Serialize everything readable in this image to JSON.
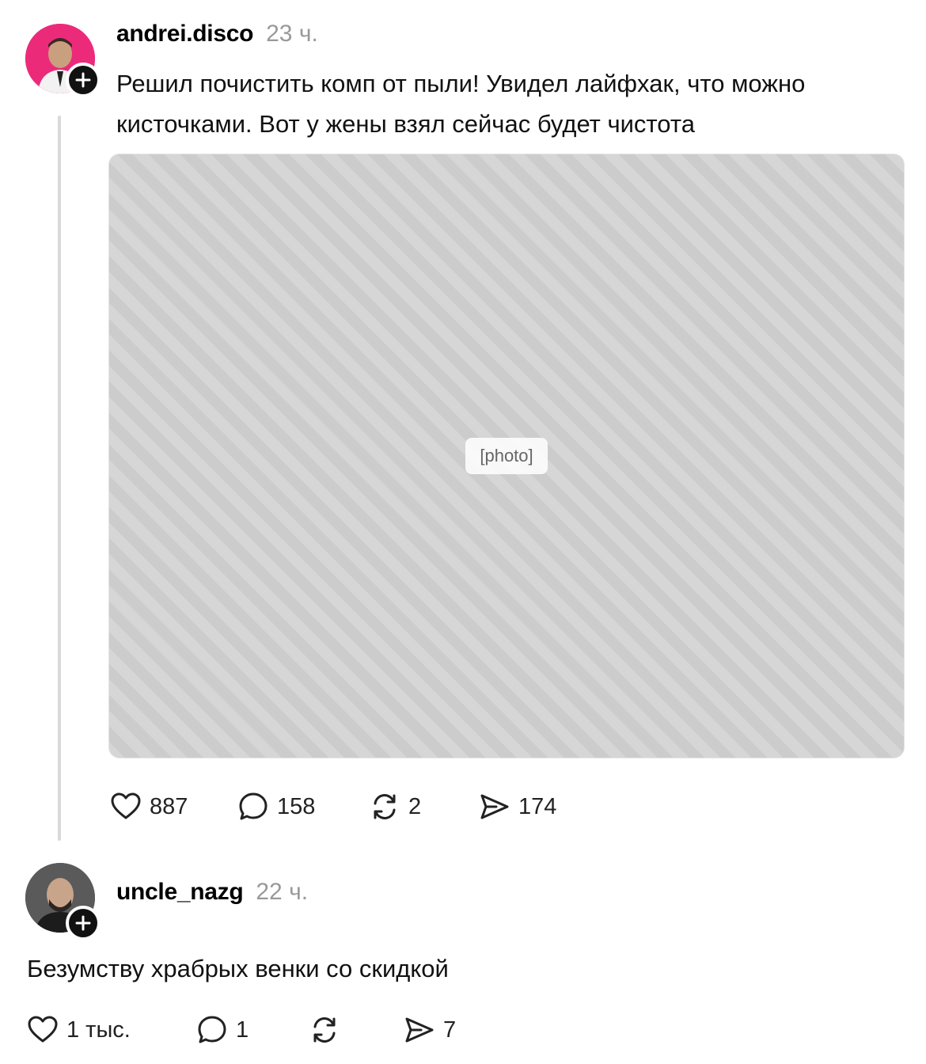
{
  "post": {
    "username": "andrei.disco",
    "time": "23 ч.",
    "text": "Решил почистить комп от пыли! Увидел лайфхак, что можно кисточками. Вот у жены взял сейчас будет чистота",
    "actions": {
      "likes": "887",
      "comments": "158",
      "reposts": "2",
      "shares": "174"
    }
  },
  "reply": {
    "username": "uncle_nazg",
    "time": "22 ч.",
    "text": "Безумству храбрых венки со скидкой",
    "actions": {
      "likes": "1 тыс.",
      "comments": "1",
      "reposts": "",
      "shares": "7"
    }
  },
  "icons": {
    "like": "heart-icon",
    "comment": "comment-bubble-icon",
    "repost": "repost-icon",
    "share": "send-icon",
    "follow": "plus-icon"
  }
}
